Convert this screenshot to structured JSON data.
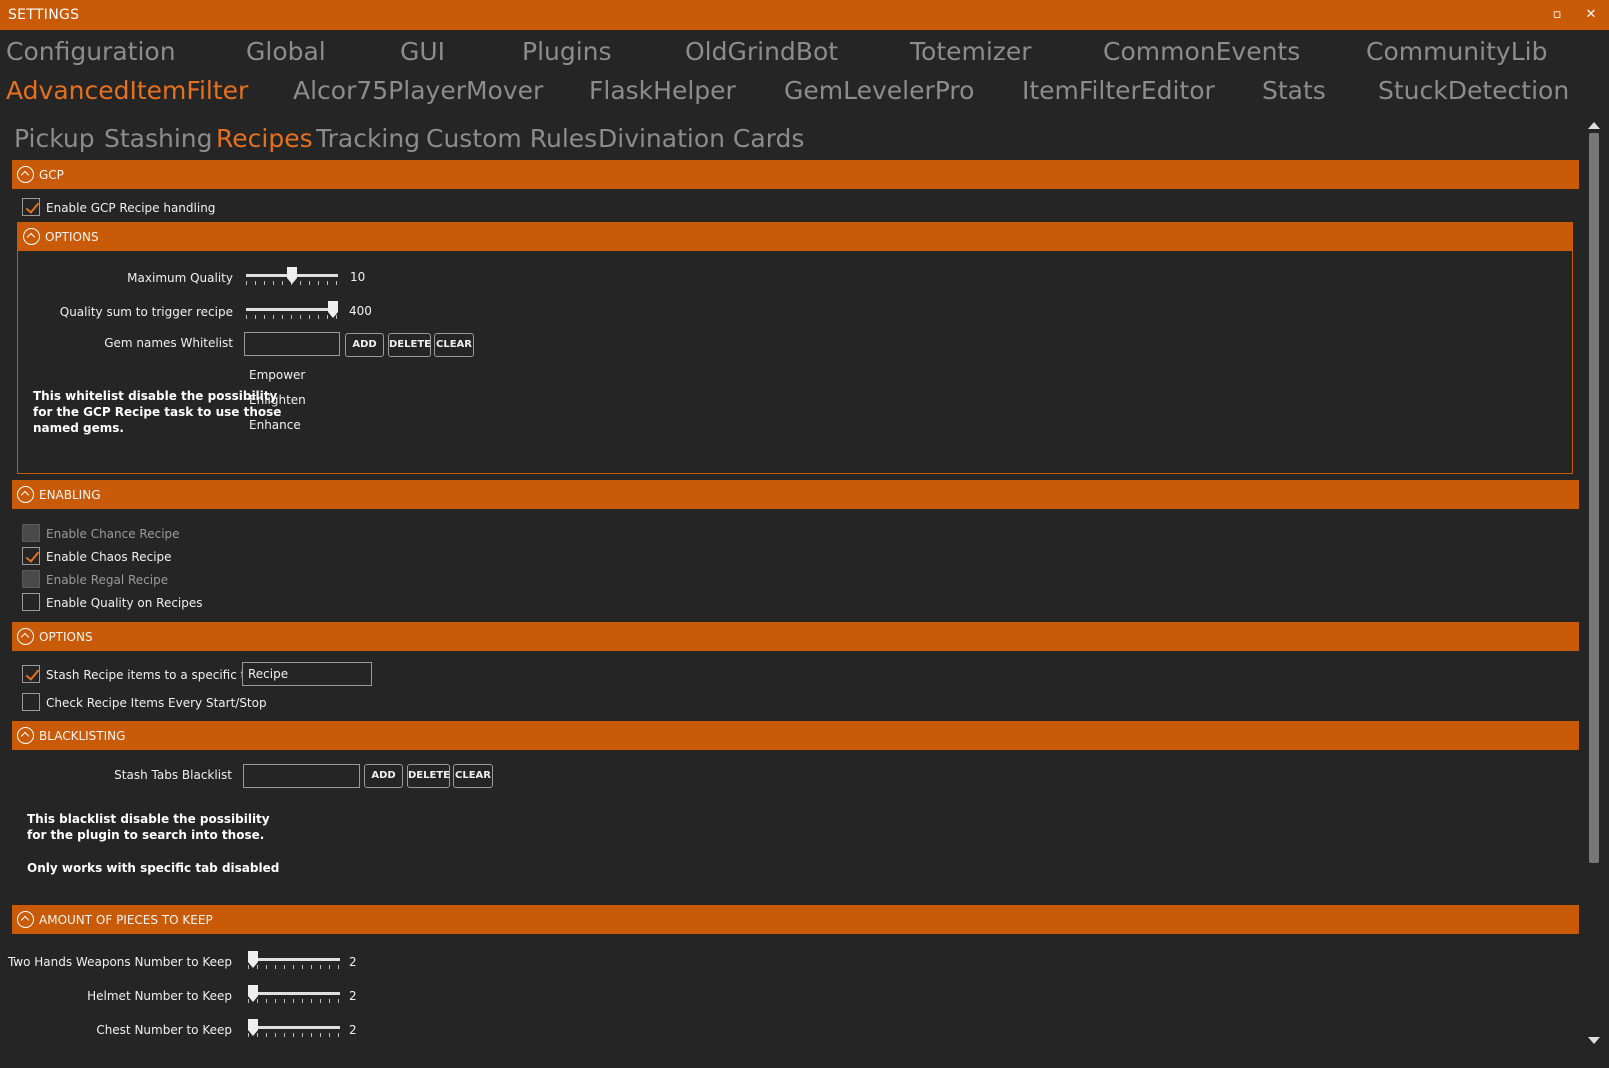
{
  "window": {
    "title": "SETTINGS",
    "maximize_glyph": "▫",
    "close_glyph": "✕"
  },
  "plugin_tabs": [
    "Configuration",
    "Global",
    "GUI",
    "Plugins",
    "OldGrindBot",
    "Totemizer",
    "CommonEvents",
    "CommunityLib",
    "AdvancedItemFilter",
    "Alcor75PlayerMover",
    "FlaskHelper",
    "GemLevelerPro",
    "ItemFilterEditor",
    "Stats",
    "StuckDetection"
  ],
  "active_plugin_tab": "AdvancedItemFilter",
  "sub_tabs": [
    "Pickup",
    "Stashing",
    "Recipes",
    "Tracking",
    "Custom Rules",
    "Divination Cards"
  ],
  "active_sub_tab": "Recipes",
  "gcp": {
    "header": "GCP",
    "enable_label": "Enable GCP Recipe handling",
    "enable_checked": true,
    "options": {
      "header": "OPTIONS",
      "max_quality_label": "Maximum Quality",
      "max_quality_value": "10",
      "max_quality_fraction": 0.5,
      "quality_sum_label": "Quality sum to trigger recipe",
      "quality_sum_value": "400",
      "quality_sum_fraction": 1.0,
      "whitelist_label": "Gem names Whitelist",
      "whitelist_input": "",
      "add_label": "ADD",
      "delete_label": "DELETE",
      "clear_label": "CLEAR",
      "whitelist_items": [
        "Empower",
        "Enlighten",
        "Enhance"
      ],
      "note_lines": [
        "This whitelist disable the possibility",
        "for the GCP Recipe task to use those",
        "named gems."
      ]
    }
  },
  "enabling": {
    "header": "ENABLING",
    "items": [
      {
        "label": "Enable Chance Recipe",
        "checked": false,
        "disabled": true
      },
      {
        "label": "Enable Chaos Recipe",
        "checked": true,
        "disabled": false
      },
      {
        "label": "Enable Regal Recipe",
        "checked": false,
        "disabled": true
      },
      {
        "label": "Enable Quality on Recipes",
        "checked": false,
        "disabled": false
      }
    ]
  },
  "options": {
    "header": "OPTIONS",
    "stash_label": "Stash Recipe items to a specific tab",
    "stash_checked": true,
    "stash_tab_value": "Recipe",
    "check_label": "Check Recipe Items Every Start/Stop",
    "check_checked": false
  },
  "blacklisting": {
    "header": "BLACKLISTING",
    "label": "Stash Tabs Blacklist",
    "input": "",
    "add_label": "ADD",
    "delete_label": "DELETE",
    "clear_label": "CLEAR",
    "note_lines": [
      "This blacklist disable the possibility",
      "for the plugin to search into those."
    ],
    "note2": "Only works with specific tab disabled"
  },
  "pieces": {
    "header": "AMOUNT OF PIECES TO KEEP",
    "rows": [
      {
        "label": "Two Hands Weapons Number to Keep",
        "value": "2",
        "fraction": 0.0
      },
      {
        "label": "Helmet Number to Keep",
        "value": "2",
        "fraction": 0.0
      },
      {
        "label": "Chest Number to Keep",
        "value": "2",
        "fraction": 0.0
      }
    ]
  },
  "colors": {
    "accent": "#c95a07",
    "active_tab": "#e5711e",
    "background": "#252525"
  }
}
